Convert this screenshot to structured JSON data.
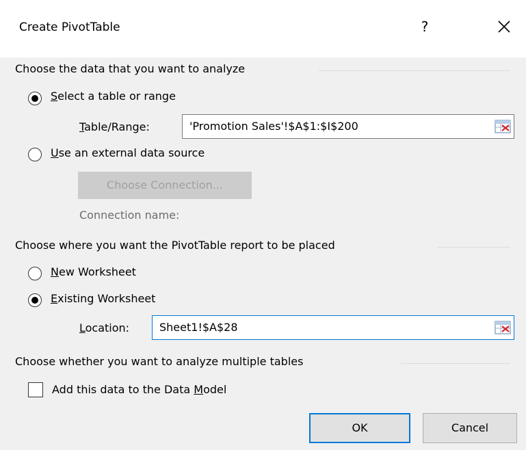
{
  "dialog": {
    "title": "Create PivotTable",
    "help_label": "?",
    "close_icon": "close-icon"
  },
  "data_section": {
    "heading": "Choose the data that you want to analyze",
    "select_range": {
      "mnemonic": "S",
      "rest": "elect a table or range",
      "checked": true
    },
    "table_range": {
      "mnemonic": "T",
      "rest": "able/Range:",
      "value": "'Promotion Sales'!$A$1:$I$200"
    },
    "external": {
      "mnemonic": "U",
      "rest": "se an external data source",
      "checked": false
    },
    "choose_connection_label": "Choose Connection...",
    "connection_name_label": "Connection name:"
  },
  "placement_section": {
    "heading": "Choose where you want the PivotTable report to be placed",
    "new_worksheet": {
      "mnemonic": "N",
      "rest": "ew Worksheet",
      "checked": false
    },
    "existing_worksheet": {
      "mnemonic": "E",
      "rest": "xisting Worksheet",
      "checked": true
    },
    "location": {
      "mnemonic": "L",
      "rest": "ocation:",
      "value": "Sheet1!$A$28"
    }
  },
  "multiple_section": {
    "heading": "Choose whether you want to analyze multiple tables",
    "add_to_model": {
      "prefix": "Add this data to the Data ",
      "mnemonic": "M",
      "rest": "odel",
      "checked": false
    }
  },
  "buttons": {
    "ok": "OK",
    "cancel": "Cancel"
  },
  "colors": {
    "accent": "#0078d7",
    "titlebar_bg": "#ffffff",
    "dialog_bg": "#f0f0f0"
  }
}
